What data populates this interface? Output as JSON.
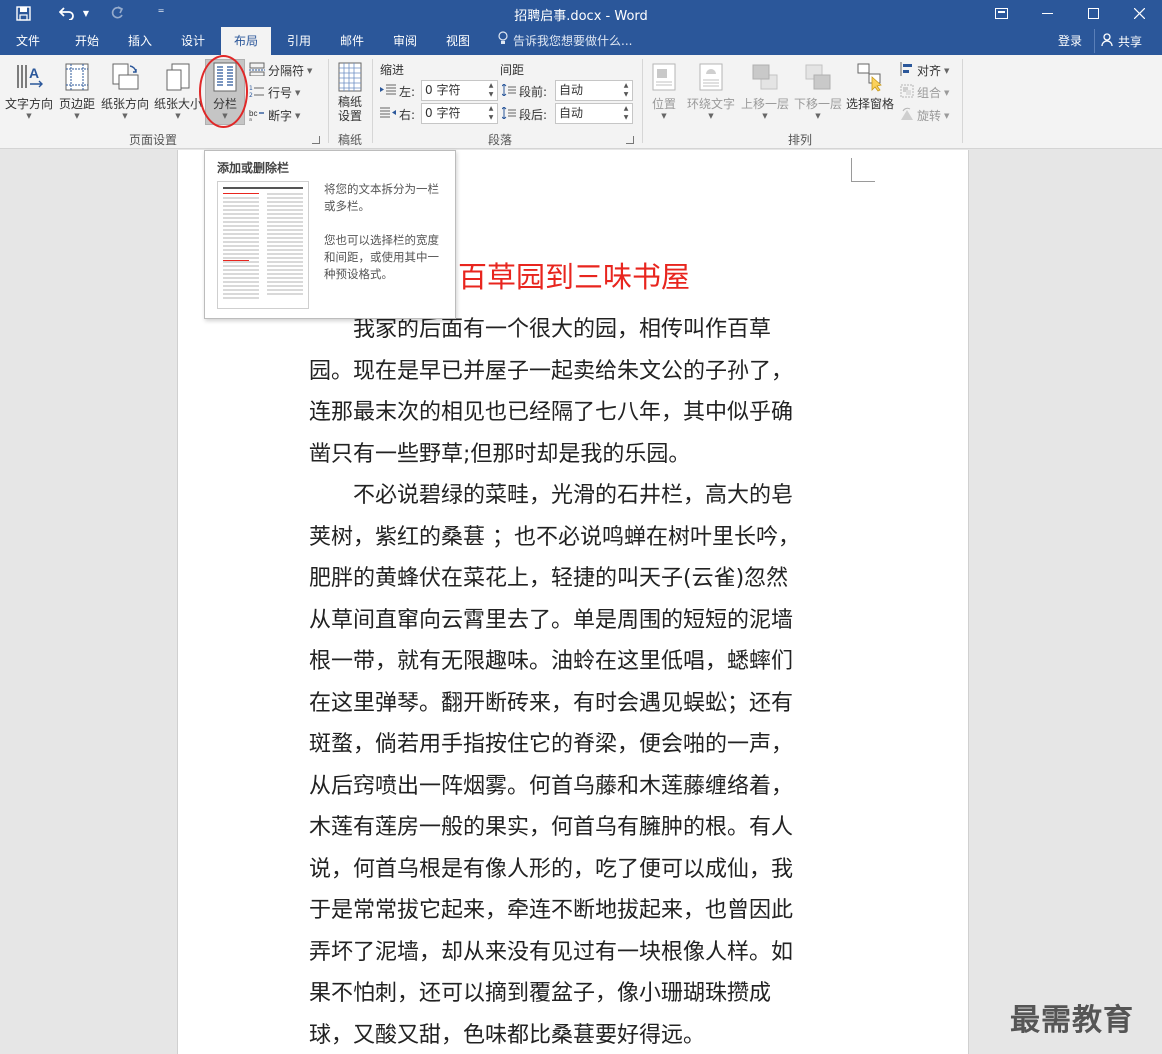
{
  "titlebar": {
    "document_title": "招聘启事.docx - Word",
    "qat_more": "⁼"
  },
  "tabs": [
    {
      "label": "文件"
    },
    {
      "label": "开始"
    },
    {
      "label": "插入"
    },
    {
      "label": "设计"
    },
    {
      "label": "布局"
    },
    {
      "label": "引用"
    },
    {
      "label": "邮件"
    },
    {
      "label": "审阅"
    },
    {
      "label": "视图"
    }
  ],
  "tell_me": "告诉我您想要做什么...",
  "account": {
    "login": "登录",
    "share": "共享"
  },
  "ribbon": {
    "page_setup": {
      "group_label": "页面设置",
      "text_direction": "文字方向",
      "margins": "页边距",
      "orientation": "纸张方向",
      "size": "纸张大小",
      "columns": "分栏",
      "breaks": "分隔符",
      "line_numbers": "行号",
      "hyphenation": "断字"
    },
    "manuscript": {
      "group_label": "稿纸",
      "settings_line1": "稿纸",
      "settings_line2": "设置"
    },
    "paragraph": {
      "group_label": "段落",
      "indent_label": "缩进",
      "spacing_label": "间距",
      "left_label": "左:",
      "right_label": "右:",
      "before_label": "段前:",
      "after_label": "段后:",
      "left_value": "0 字符",
      "right_value": "0 字符",
      "before_value": "自动",
      "after_value": "自动"
    },
    "arrange": {
      "group_label": "排列",
      "position": "位置",
      "wrap_text": "环绕文字",
      "bring_forward": "上移一层",
      "send_backward": "下移一层",
      "selection_pane": "选择窗格",
      "align": "对齐",
      "group": "组合",
      "rotate": "旋转"
    }
  },
  "tooltip": {
    "title": "添加或删除栏",
    "desc1": "将您的文本拆分为一栏或多栏。",
    "desc2": "您也可以选择栏的宽度和间距，或使用其中一种预设格式。"
  },
  "document": {
    "title_visible": "百草园到三味书屋",
    "lines": [
      "　　我家的后面有一个很大的园，相传叫作百草",
      "园。现在是早已并屋子一起卖给朱文公的子孙了，",
      "连那最末次的相见也已经隔了七八年，其中似乎确",
      "凿只有一些野草;但那时却是我的乐园。",
      "　　不必说碧绿的菜畦，光滑的石井栏，高大的皂",
      "荚树，紫红的桑葚 ；也不必说鸣蝉在树叶里长吟，",
      "肥胖的黄蜂伏在菜花上，轻捷的叫天子(云雀)忽然",
      "从草间直窜向云霄里去了。单是周围的短短的泥墙",
      "根一带，就有无限趣味。油蛉在这里低唱，蟋蟀们",
      "在这里弹琴。翻开断砖来，有时会遇见蜈蚣；还有",
      "斑蝥，倘若用手指按住它的脊梁，便会啪的一声，",
      "从后窍喷出一阵烟雾。何首乌藤和木莲藤缠络着，",
      "木莲有莲房一般的果实，何首乌有臃肿的根。有人",
      "说，何首乌根是有像人形的，吃了便可以成仙，我",
      "于是常常拔它起来，牵连不断地拔起来，也曾因此",
      "弄坏了泥墙，却从来没有见过有一块根像人样。如",
      "果不怕刺，还可以摘到覆盆子，像小珊瑚珠攒成",
      "球，又酸又甜，色味都比桑葚要好得远。"
    ]
  },
  "watermark": "最需教育",
  "colors": {
    "word_blue": "#2b579a",
    "title_red": "#e8251e",
    "highlight_red": "#e02828"
  }
}
